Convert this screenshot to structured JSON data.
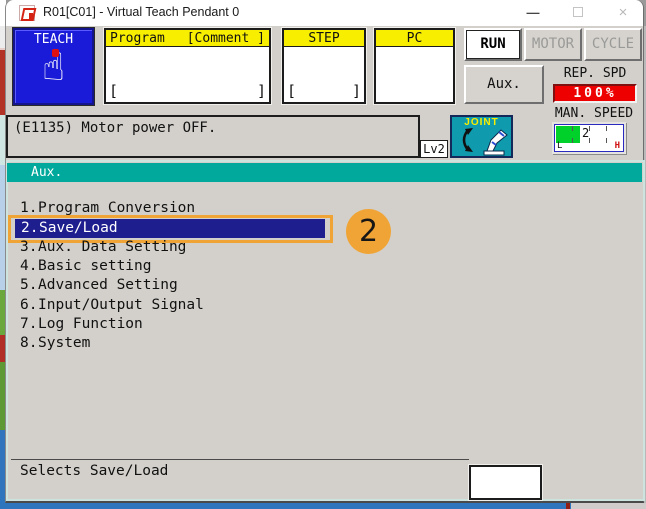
{
  "window": {
    "title": "R01[C01] - Virtual Teach Pendant 0",
    "icon": "teach-pendant-app-icon",
    "minimize_glyph": "—",
    "close_glyph": "×"
  },
  "toolbar": {
    "teach": {
      "label": "TEACH",
      "icon": "hand-pointing-up-icon"
    },
    "program_box": {
      "header_left": "Program",
      "header_right": "[Comment ]",
      "open_bracket": "[",
      "close_bracket": "]"
    },
    "step_box": {
      "header": "STEP",
      "open_bracket": "[",
      "close_bracket": "]"
    },
    "pc_box": {
      "header": "PC"
    },
    "run_label": "RUN",
    "motor_label": "MOTOR",
    "cycle_label": "CYCLE",
    "aux_label": "Aux.",
    "rep_spd": {
      "label": "REP. SPD",
      "value": "100%"
    },
    "man_speed": {
      "label": "MAN. SPEED",
      "value": "2",
      "low": "L",
      "high": "H"
    }
  },
  "status_bar": {
    "message": "(E1135) Motor power OFF.",
    "level": "Lv2",
    "mode": {
      "label": "JOINT",
      "icon": "joint-mode-robot-arm-icon"
    }
  },
  "screen": {
    "title": "Aux.",
    "menu": [
      {
        "num": "1.",
        "label": "Program Conversion",
        "selected": false
      },
      {
        "num": "2.",
        "label": "Save/Load",
        "selected": true
      },
      {
        "num": "3.",
        "label": "Aux. Data Setting",
        "selected": false
      },
      {
        "num": "4.",
        "label": "Basic setting",
        "selected": false
      },
      {
        "num": "5.",
        "label": "Advanced Setting",
        "selected": false
      },
      {
        "num": "6.",
        "label": "Input/Output Signal",
        "selected": false
      },
      {
        "num": "7.",
        "label": "Log Function",
        "selected": false
      },
      {
        "num": "8.",
        "label": "System",
        "selected": false
      }
    ],
    "footer_hint": "Selects Save/Load"
  },
  "annotation": {
    "step_badge": "2"
  },
  "colors": {
    "teach_blue": "#1a1ad9",
    "header_yellow": "#f8ee00",
    "screen_titlebar_teal": "#00a99c",
    "joint_icon_teal": "#0f9aae",
    "selected_row_navy": "#1e1e8f",
    "annotation_orange": "#f0a435",
    "rep_spd_red": "#ee0000",
    "gauge_green": "#00d02a",
    "panel_gray": "#d3d0cb",
    "desktop_blue": "#2e75be"
  }
}
